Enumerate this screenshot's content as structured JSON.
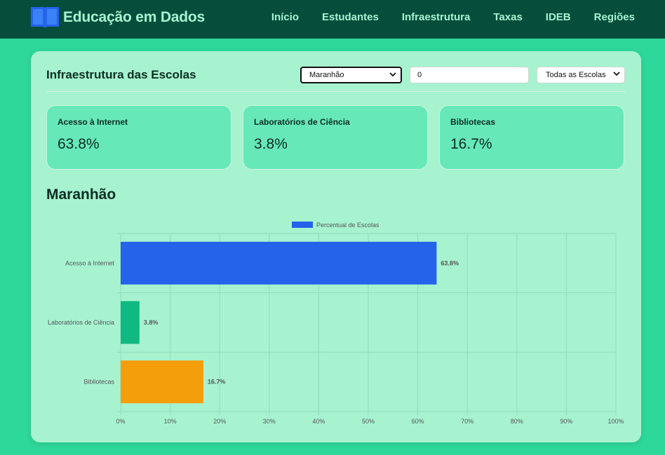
{
  "app": {
    "title": "Educação em Dados"
  },
  "nav": {
    "items": [
      "Início",
      "Estudantes",
      "Infraestrutura",
      "Taxas",
      "IDEB",
      "Regiões"
    ]
  },
  "page": {
    "title": "Infraestrutura das Escolas",
    "state_select": "Maranhão",
    "year_input": "0",
    "school_select": "Todas as Escolas",
    "region_heading": "Maranhão"
  },
  "stats": [
    {
      "label": "Acesso à Internet",
      "value": "63.8%"
    },
    {
      "label": "Laboratórios de Ciência",
      "value": "3.8%"
    },
    {
      "label": "Bibliotecas",
      "value": "16.7%"
    }
  ],
  "colors": {
    "nav_bg": "#064e3b",
    "page_bg": "#2ed89a",
    "card_bg": "#a7f3d0",
    "stat_bg": "#67e8b9",
    "bar_internet": "#2563eb",
    "bar_labs": "#10b981",
    "bar_library": "#f59e0b"
  },
  "chart_data": {
    "type": "bar",
    "orientation": "horizontal",
    "categories": [
      "Acesso à Internet",
      "Laboratórios de Ciência",
      "Bibliotecas"
    ],
    "series": [
      {
        "name": "Percentual de Escolas",
        "values": [
          63.8,
          3.8,
          16.7
        ]
      }
    ],
    "bar_colors": [
      "#2563eb",
      "#10b981",
      "#f59e0b"
    ],
    "data_labels": [
      "63.8%",
      "3.8%",
      "16.7%"
    ],
    "xlim": [
      0,
      100
    ],
    "x_ticks": [
      "0%",
      "10%",
      "20%",
      "30%",
      "40%",
      "50%",
      "60%",
      "70%",
      "80%",
      "90%",
      "100%"
    ],
    "grid": true,
    "legend": "top-center"
  }
}
